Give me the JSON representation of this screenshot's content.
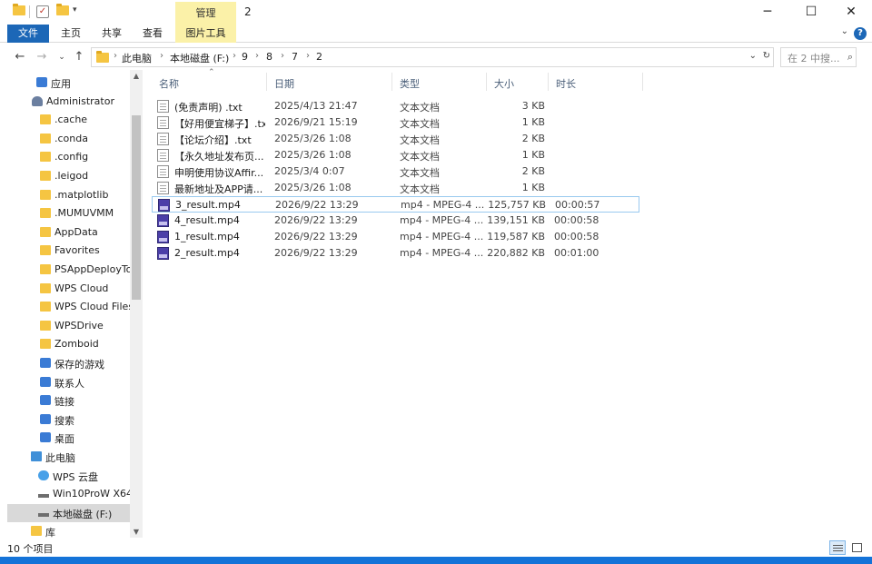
{
  "window": {
    "ribbon_context_group": "管理",
    "title": "2",
    "controls": {
      "minimize": "─",
      "maximize": "☐",
      "close": "✕"
    }
  },
  "ribbon": {
    "tabs": [
      "文件",
      "主页",
      "共享",
      "查看",
      "图片工具"
    ],
    "help": "?"
  },
  "address": {
    "crumbs": [
      "此电脑",
      "本地磁盘 (F:)",
      "9",
      "8",
      "7",
      "2"
    ],
    "search_placeholder": "在 2 中搜..."
  },
  "sidebar": {
    "items": [
      {
        "label": "应用",
        "icon": "apps-icon"
      },
      {
        "label": "Administrator",
        "icon": "user-icon"
      },
      {
        "label": ".cache",
        "icon": "folder-icon"
      },
      {
        "label": ".conda",
        "icon": "folder-icon"
      },
      {
        "label": ".config",
        "icon": "folder-icon"
      },
      {
        "label": ".leigod",
        "icon": "folder-icon"
      },
      {
        "label": ".matplotlib",
        "icon": "folder-icon"
      },
      {
        "label": ".MUMUVMM",
        "icon": "folder-icon"
      },
      {
        "label": "AppData",
        "icon": "folder-icon"
      },
      {
        "label": "Favorites",
        "icon": "folder-icon"
      },
      {
        "label": "PSAppDeployToo",
        "icon": "folder-icon"
      },
      {
        "label": "WPS Cloud",
        "icon": "folder-icon"
      },
      {
        "label": "WPS Cloud Files",
        "icon": "folder-icon"
      },
      {
        "label": "WPSDrive",
        "icon": "folder-icon"
      },
      {
        "label": "Zomboid",
        "icon": "folder-icon"
      },
      {
        "label": "保存的游戏",
        "icon": "saved-games-icon"
      },
      {
        "label": "联系人",
        "icon": "contacts-icon"
      },
      {
        "label": "链接",
        "icon": "links-icon"
      },
      {
        "label": "搜索",
        "icon": "search-icon"
      },
      {
        "label": "桌面",
        "icon": "desktop-icon"
      },
      {
        "label": "此电脑",
        "icon": "this-pc-icon"
      },
      {
        "label": "WPS 云盘",
        "icon": "cloud-icon"
      },
      {
        "label": "Win10ProW X64",
        "icon": "drive-icon"
      },
      {
        "label": "本地磁盘 (F:)",
        "icon": "drive-icon",
        "selected": true
      },
      {
        "label": "库",
        "icon": "library-icon"
      }
    ]
  },
  "columns": [
    "名称",
    "日期",
    "类型",
    "大小",
    "时长"
  ],
  "files": [
    {
      "name": "(免责声明) .txt",
      "date": "2025/4/13 21:47",
      "type": "文本文档",
      "size": "3 KB",
      "duration": "",
      "kind": "txt"
    },
    {
      "name": "【好用便宜梯子】.txt",
      "date": "2026/9/21 15:19",
      "type": "文本文档",
      "size": "1 KB",
      "duration": "",
      "kind": "txt"
    },
    {
      "name": "【论坛介绍】.txt",
      "date": "2025/3/26 1:08",
      "type": "文本文档",
      "size": "2 KB",
      "duration": "",
      "kind": "txt"
    },
    {
      "name": "【永久地址发布页...",
      "date": "2025/3/26 1:08",
      "type": "文本文档",
      "size": "1 KB",
      "duration": "",
      "kind": "txt"
    },
    {
      "name": "申明使用协议Affir...",
      "date": "2025/3/4 0:07",
      "type": "文本文档",
      "size": "2 KB",
      "duration": "",
      "kind": "txt"
    },
    {
      "name": "最新地址及APP请...",
      "date": "2025/3/26 1:08",
      "type": "文本文档",
      "size": "1 KB",
      "duration": "",
      "kind": "txt"
    },
    {
      "name": "3_result.mp4",
      "date": "2026/9/22 13:29",
      "type": "mp4 - MPEG-4 ...",
      "size": "125,757 KB",
      "duration": "00:00:57",
      "kind": "mp4",
      "selected": true
    },
    {
      "name": "4_result.mp4",
      "date": "2026/9/22 13:29",
      "type": "mp4 - MPEG-4 ...",
      "size": "139,151 KB",
      "duration": "00:00:58",
      "kind": "mp4"
    },
    {
      "name": "1_result.mp4",
      "date": "2026/9/22 13:29",
      "type": "mp4 - MPEG-4 ...",
      "size": "119,587 KB",
      "duration": "00:00:58",
      "kind": "mp4"
    },
    {
      "name": "2_result.mp4",
      "date": "2026/9/22 13:29",
      "type": "mp4 - MPEG-4 ...",
      "size": "220,882 KB",
      "duration": "00:01:00",
      "kind": "mp4"
    }
  ],
  "status": {
    "item_count": "10 个项目"
  },
  "colors": {
    "accent": "#1c67b7",
    "context_tab": "#fbf1a8",
    "selection_border": "#99c9ef"
  }
}
